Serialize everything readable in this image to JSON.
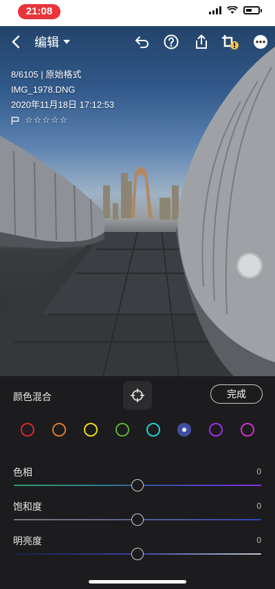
{
  "status_bar": {
    "time": "21:08"
  },
  "toolbar": {
    "title": "编辑",
    "icons": [
      "back-icon",
      "undo-icon",
      "help-icon",
      "share-icon",
      "crop-warning-icon",
      "more-icon"
    ]
  },
  "photo_info": {
    "index": "8/6105 | 原始格式",
    "filename": "IMG_1978.DNG",
    "datetime": "2020年11月18日 17:12:53",
    "rating": "☆☆☆☆☆"
  },
  "panel": {
    "title": "颜色混合",
    "done_label": "完成",
    "colors": [
      {
        "name": "red",
        "hex": "#e0262e"
      },
      {
        "name": "orange",
        "hex": "#e8772a"
      },
      {
        "name": "yellow",
        "hex": "#eede1c"
      },
      {
        "name": "green",
        "hex": "#5cb536"
      },
      {
        "name": "aqua",
        "hex": "#25d2d6"
      },
      {
        "name": "blue",
        "hex": "#3f4fa0",
        "selected": true
      },
      {
        "name": "purple",
        "hex": "#a12ef0"
      },
      {
        "name": "magenta",
        "hex": "#d230d8"
      }
    ],
    "sliders": [
      {
        "label": "色相",
        "value": "0"
      },
      {
        "label": "饱和度",
        "value": "0"
      },
      {
        "label": "明亮度",
        "value": "0"
      }
    ]
  }
}
